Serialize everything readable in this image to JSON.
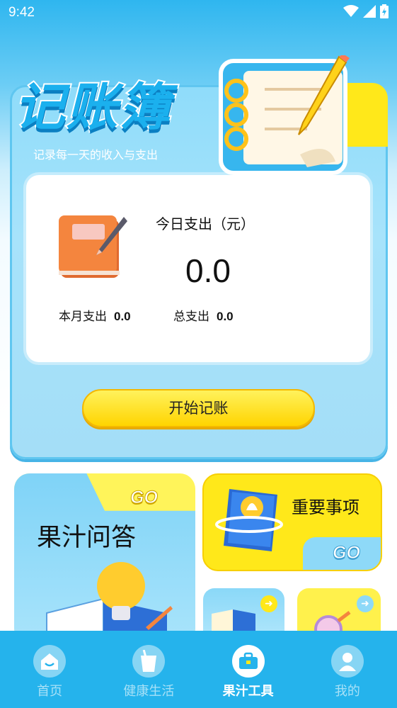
{
  "status_bar": {
    "time": "9:42",
    "icons": [
      "wifi-icon",
      "signal-icon",
      "battery-charging-icon"
    ]
  },
  "header": {
    "title": "记账簿",
    "subtitle": "记录每一天的收入与支出"
  },
  "stats": {
    "today_label": "今日支出（元）",
    "today_value": "0.0",
    "month_label": "本月支出",
    "month_value": "0.0",
    "total_label": "总支出",
    "total_value": "0.0"
  },
  "actions": {
    "start_label": "开始记账"
  },
  "features": {
    "qa": {
      "title": "果汁问答",
      "go": "GO"
    },
    "important": {
      "title": "重要事项",
      "go": "GO"
    }
  },
  "bottom_nav": {
    "items": [
      {
        "label": "首页",
        "icon": "home-icon",
        "active": false
      },
      {
        "label": "健康生活",
        "icon": "drink-cup-icon",
        "active": false
      },
      {
        "label": "果汁工具",
        "icon": "toolbox-icon",
        "active": true
      },
      {
        "label": "我的",
        "icon": "user-icon",
        "active": false
      }
    ]
  },
  "colors": {
    "primary_blue": "#25b3ec",
    "accent_yellow": "#ffe81a",
    "title_blue": "#1bb0ee"
  }
}
